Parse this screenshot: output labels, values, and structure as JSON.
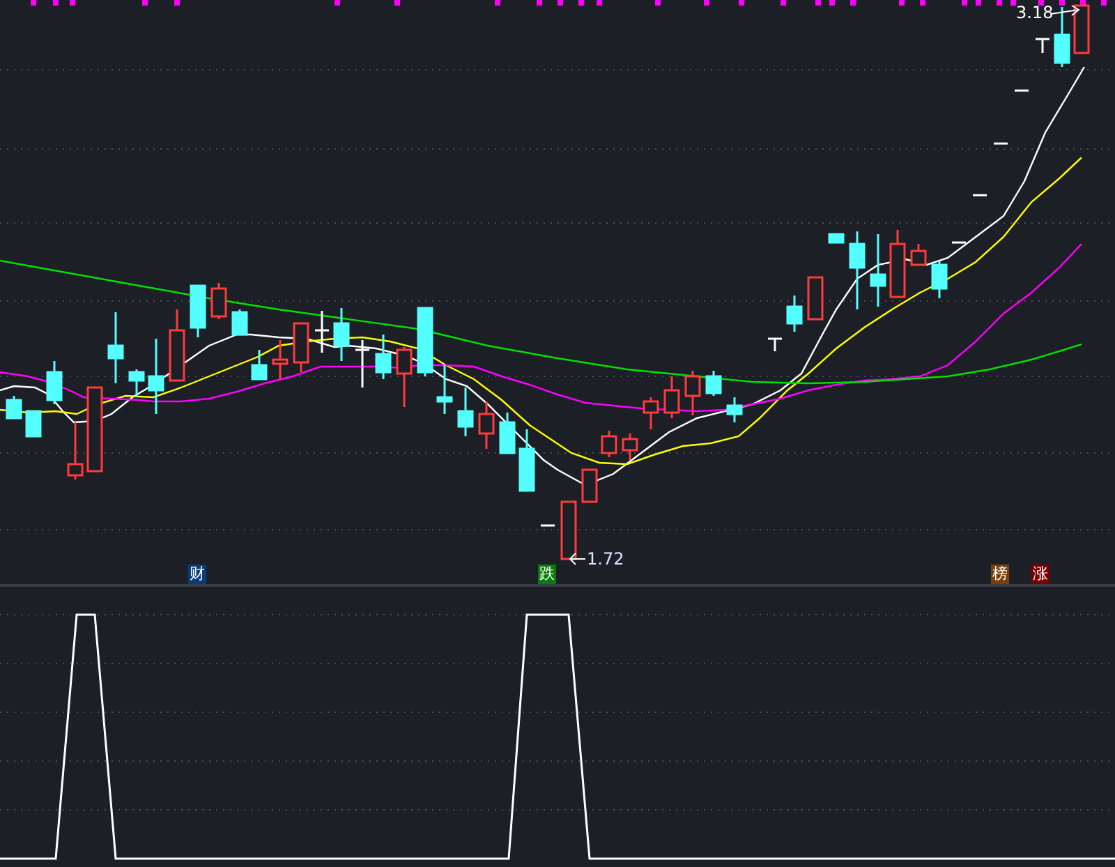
{
  "price_chart": {
    "high_label": {
      "text": "3.18"
    },
    "low_label": {
      "text": "1.72"
    },
    "signals": [
      {
        "text": "财",
        "color": "#0a3d78"
      },
      {
        "text": "跌",
        "color": "#0a7a0a"
      },
      {
        "text": "榜",
        "color": "#7a3f0a"
      },
      {
        "text": "涨",
        "color": "#7a0000"
      }
    ]
  }
}
